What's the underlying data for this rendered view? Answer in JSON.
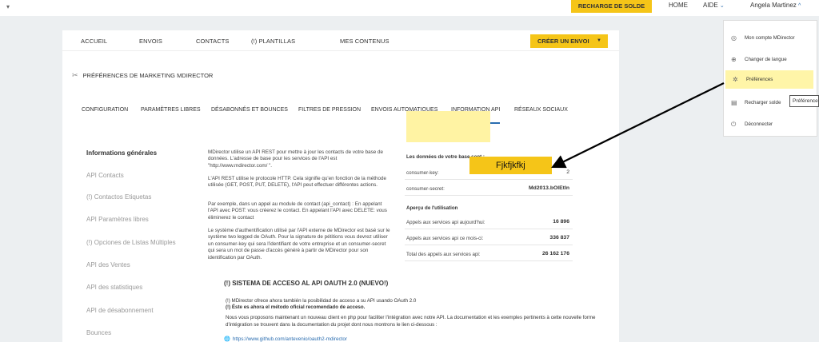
{
  "topbar": {
    "recharge_label": "RECHARGE DE SOLDE",
    "home_label": "HOME",
    "aide_label": "AIDE",
    "user_name": "Angela Martinez",
    "dropdown_icon": "chevron-down-icon"
  },
  "mainnav": {
    "items": [
      "ACCUEIL",
      "ENVOIS",
      "CONTACTS",
      "(!) PLANTILLAS",
      "MES CONTENUS"
    ],
    "create_label": "CRÉER UN ENVOI"
  },
  "page_title": "PRÉFÉRENCES DE MARKETING MDIRECTOR",
  "subnav": {
    "items": [
      "CONFIGURATION",
      "PARAMÈTRES LIBRES",
      "DÉSABONNÉS ET BOUNCES",
      "FILTRES DE PRESSION",
      "ENVOIS AUTOMATIQUES",
      "INFORMATION API",
      "RÉSEAUX SOCIAUX"
    ],
    "active": "INFORMATION API"
  },
  "sidenav": {
    "items": [
      "Informations générales",
      "API Contacts",
      "(!) Contactos Etiquetas",
      "API Paramètres libres",
      "(!) Opciones de Listas Múltiples",
      "API des Ventes",
      "API des statistiques",
      "API de désabonnement",
      "Bounces"
    ]
  },
  "content": {
    "p1": "MDirector utilise un API REST pour mettre à jour les contacts de votre base de données. L'adresse de base pour les services de l'API est \"http://www.mdirector.com/ \".",
    "p2": "L'API REST utilise le protocole HTTP. Cela signifie qu'en fonction de la méthode utilisée (GET, POST, PUT, DELETE), l'API peut effectuer différentes actions.",
    "p3": "Par exemple, dans un appel au module de contact (api_contact) : En appelant l'API avec POST: vous créerez le contact. En appelant l'API avec DELETE: vous éliminerez le contact",
    "p4": "Le système d'authentification utilisé par l'API externe de MDirector est basé sur le système two legged de OAuth. Pour la signature de pétitions vous devrez utiliser un consumer-key qui sera l'identifiant de votre entreprise et un consumer-secret qui sera un mot de passe d'accès généré à partir de MDirector pour son identification par OAuth.",
    "oauth_title": "(!) SISTEMA DE ACCESO AL API OAUTH 2.0 (NUEVO!)",
    "oauth_line1": "(!) MDirector ofrece ahora también la posibilidad de acceso a su API usando OAuth 2.0",
    "oauth_line2": "(!) Éste es ahora el método oficial recomendado de acceso.",
    "oauth_line3": "Nous vous proposons maintenant un nouveau client en php pour faciliter l'intégration avec notre API. La documentation et les exemples pertinents à cette nouvelle forme d'intégration se trouvent dans la documentation du projet dont nous montrons le lien ci-dessous :",
    "link": "https://www.github.com/antevenio/oauth2-mdirector"
  },
  "data_table": {
    "header1": "Les données de votre base sont :",
    "consumer_key_label": "consumer-key:",
    "consumer_key_value": "2",
    "consumer_secret_label": "consumer-secret:",
    "consumer_secret_value": "Md2013.bOlEtIn",
    "header2": "Aperçu de l'utilisation",
    "usage": [
      {
        "label": "Appels aux services api aujourd'hui:",
        "value": "16 896"
      },
      {
        "label": "Appels aux services api ce mois-ci:",
        "value": "336 837"
      },
      {
        "label": "Total des appels aux services api:",
        "value": "26 162 176"
      }
    ]
  },
  "annotation": {
    "text": "Fjkfjkfkj"
  },
  "user_menu": {
    "items": [
      {
        "label": "Mon compte MDirector",
        "icon": "account-icon"
      },
      {
        "label": "Changer de langue",
        "icon": "globe-icon"
      },
      {
        "label": "Préférences",
        "icon": "settings-icon"
      },
      {
        "label": "Recharger solde",
        "icon": "wallet-icon"
      },
      {
        "label": "Déconnecter",
        "icon": "power-icon"
      }
    ],
    "tooltip": "Préférences"
  }
}
